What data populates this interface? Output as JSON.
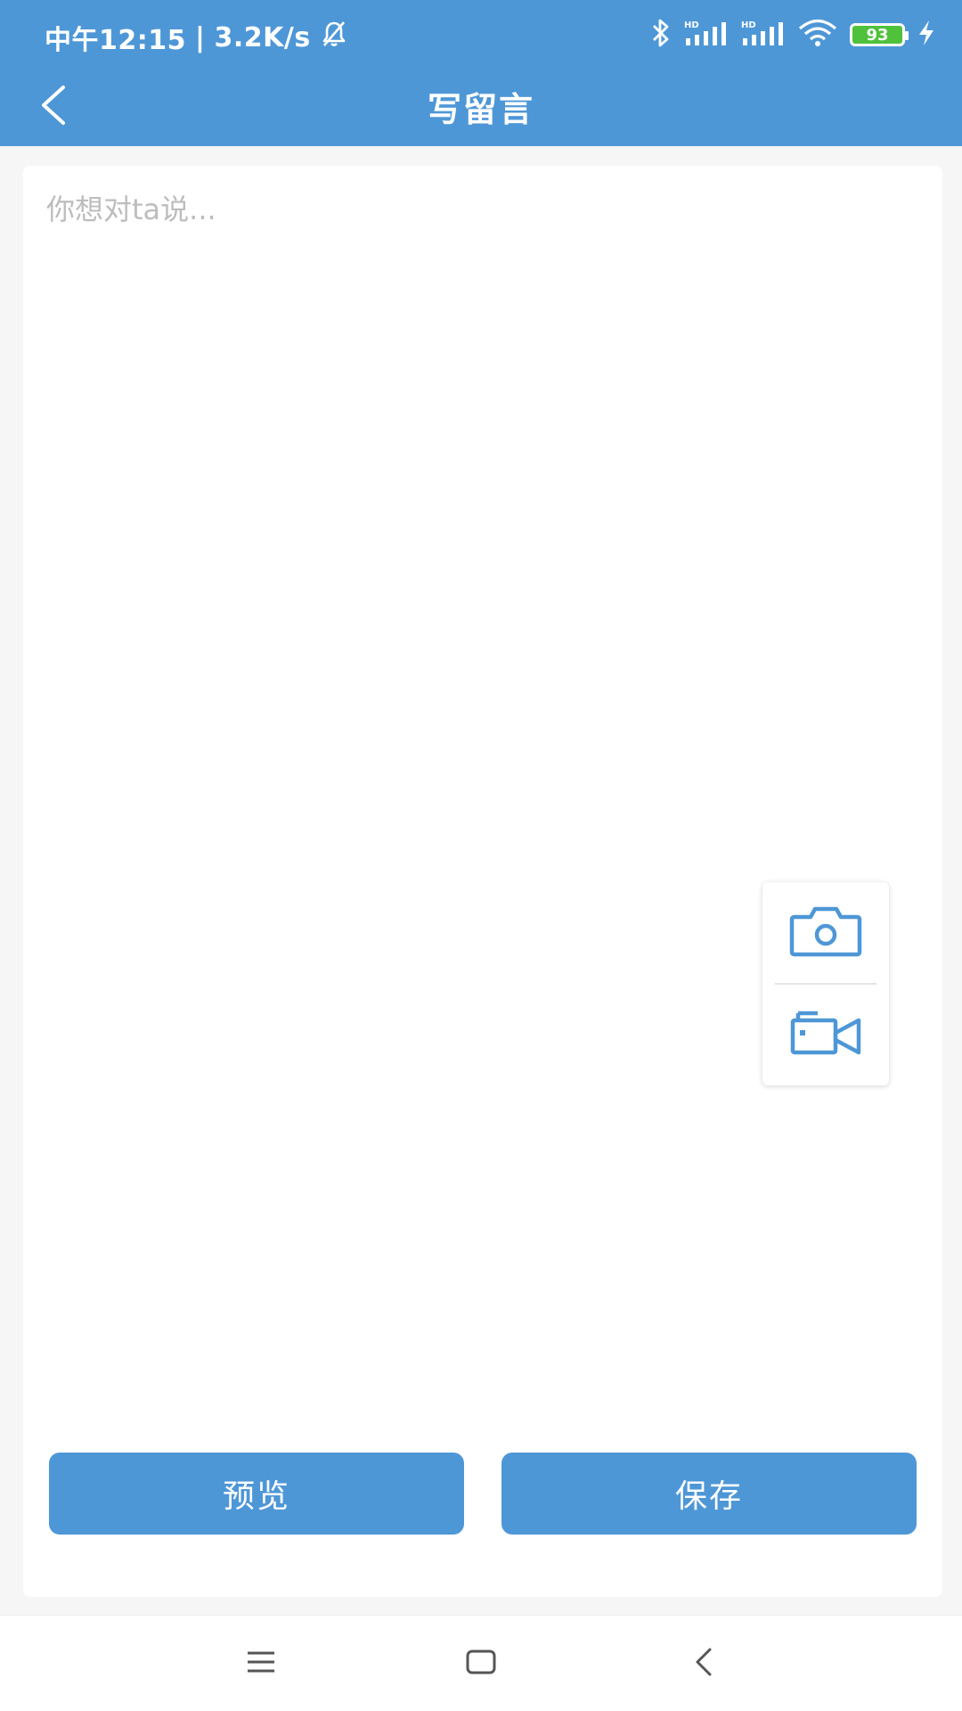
{
  "status_bar": {
    "time": "中午12:15",
    "separator": "|",
    "network_speed": "3.2K/s",
    "battery_level": "93",
    "icons": [
      "bell-off-icon",
      "bluetooth-icon",
      "signal-hd-icon",
      "signal-hd-icon",
      "wifi-icon",
      "battery-icon",
      "charging-icon"
    ]
  },
  "app_bar": {
    "title": "写留言",
    "back_icon": "chevron-left-icon"
  },
  "editor": {
    "placeholder": "你想对ta说..."
  },
  "media_panel": {
    "photo_icon": "camera-icon",
    "video_icon": "video-camera-icon"
  },
  "actions": {
    "preview_label": "预览",
    "save_label": "保存"
  },
  "nav_bar": {
    "icons": [
      "menu-icon",
      "home-icon",
      "back-icon"
    ]
  },
  "colors": {
    "primary": "#4e97d7",
    "background": "#f6f6f6",
    "card": "#ffffff",
    "placeholder": "#bdbdbd",
    "battery": "#4fc13b"
  }
}
